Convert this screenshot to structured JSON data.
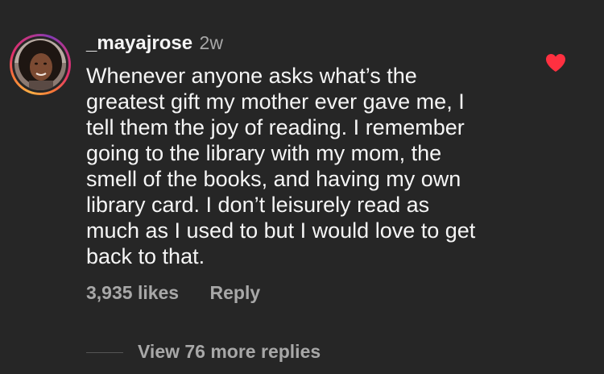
{
  "comment": {
    "username": "_mayajrose",
    "time": "2w",
    "text_lines": [
      "Whenever anyone asks what’s the",
      "greatest gift my mother ever gave me, I",
      "tell them the joy of reading. I remember",
      "going to the library with my mom, the",
      "smell of the books, and having my own",
      "library card. I don’t leisurely read as",
      "much as I used to but I would love to get",
      "back to that."
    ],
    "likes": "3,935 likes",
    "reply_label": "Reply",
    "view_replies": "View 76 more replies",
    "liked": true
  },
  "colors": {
    "background": "#262626",
    "text": "#f5f5f5",
    "secondary_text": "#a8a8a8",
    "like_heart": "#ff3040"
  },
  "icons": {
    "like": "heart-icon"
  }
}
